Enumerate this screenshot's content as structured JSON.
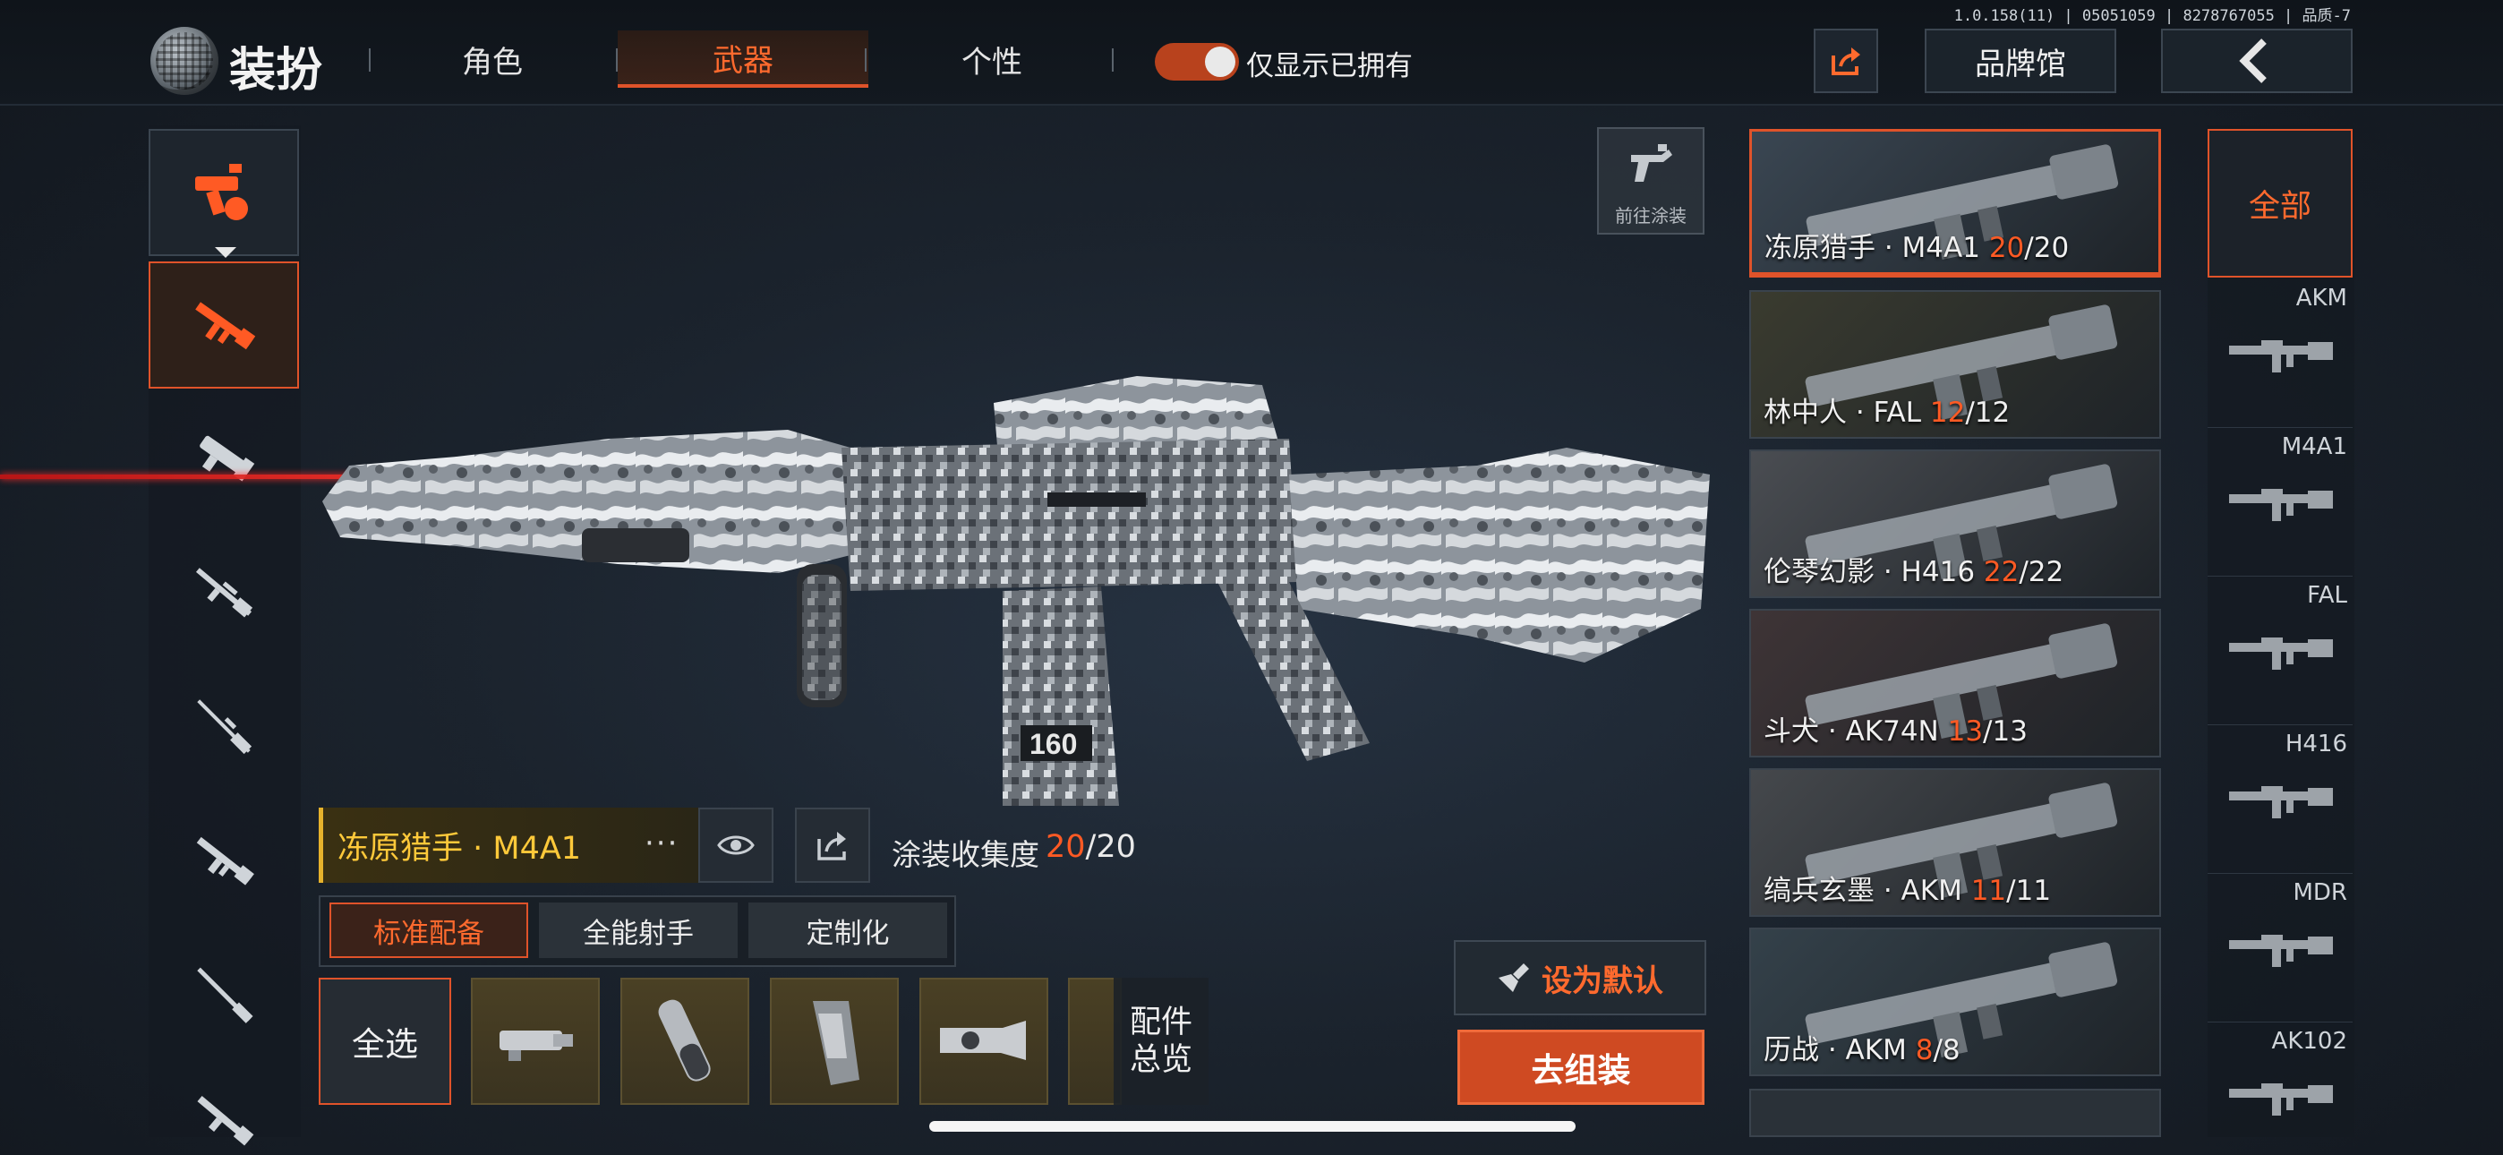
{
  "version": "1.0.158(11) | 05051059 | 8278767055 | 品质-7",
  "header": {
    "title": "装扮",
    "tabs": [
      {
        "label": "角色",
        "active": false
      },
      {
        "label": "武器",
        "active": true
      },
      {
        "label": "个性",
        "active": false
      }
    ],
    "toggle_label": "仅显示已拥有",
    "toggle_on": true,
    "brand_button": "品牌馆"
  },
  "left_categories": [
    {
      "icon": "weapon-category-icon",
      "active": false
    },
    {
      "icon": "assault-rifle-icon",
      "active": true
    },
    {
      "icon": "smg-icon",
      "active": false
    },
    {
      "icon": "marksman-rifle-icon",
      "active": false
    },
    {
      "icon": "sniper-rifle-icon",
      "active": false
    },
    {
      "icon": "rifle-icon",
      "active": false
    },
    {
      "icon": "shotgun-icon",
      "active": false
    },
    {
      "icon": "lmg-icon",
      "active": false
    }
  ],
  "goto_paint_label": "前往涂装",
  "weapon": {
    "name": "冻原猎手 · M4A1",
    "more": "···",
    "collection_label": "涂装收集度",
    "collected": "20",
    "total": "/20"
  },
  "presets": [
    {
      "label": "标准配备",
      "active": true
    },
    {
      "label": "全能射手",
      "active": false
    },
    {
      "label": "定制化",
      "active": false
    }
  ],
  "select_all": "全选",
  "parts_overview": [
    "配件",
    "总览"
  ],
  "set_default": "设为默认",
  "assemble": "去组装",
  "skins": [
    {
      "name": "冻原猎手 · M4A1 ",
      "owned": "20",
      "total": "/20",
      "active": true,
      "bg": "#3a4652"
    },
    {
      "name": "林中人 · FAL ",
      "owned": "12",
      "total": "/12",
      "active": false,
      "bg": "#3a3b2f"
    },
    {
      "name": "伦琴幻影 · H416 ",
      "owned": "22",
      "total": "/22",
      "active": false,
      "bg": "#4a4d52"
    },
    {
      "name": "斗犬 · AK74N ",
      "owned": "13",
      "total": "/13",
      "active": false,
      "bg": "#3e3436"
    },
    {
      "name": "缟兵玄墨 · AKM ",
      "owned": "11",
      "total": "/11",
      "active": false,
      "bg": "#45484c"
    },
    {
      "name": "历战 · AKM ",
      "owned": "8",
      "total": "/8",
      "active": false,
      "bg": "#34414a"
    }
  ],
  "filters": {
    "all": "全部",
    "items": [
      "AKM",
      "M4A1",
      "FAL",
      "H416",
      "MDR",
      "AK102"
    ]
  },
  "colors": {
    "accent": "#e0532a",
    "accent_text": "#ff6a2e",
    "gold": "#ffc93a",
    "laser": "#ff2b2b"
  }
}
